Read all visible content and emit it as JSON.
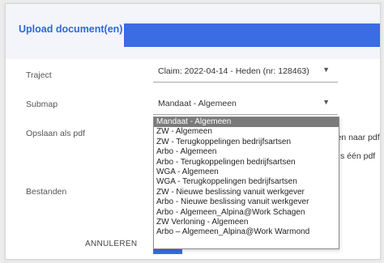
{
  "dialog": {
    "title": "Upload document(en)",
    "accent_color": "#3b6be5"
  },
  "form": {
    "traject_label": "Traject",
    "traject_value": "Claim: 2022-04-14 - Heden (nr: 128463)",
    "submap_label": "Submap",
    "submap_value": "Mandaat - Algemeen",
    "opslaan_label": "Opslaan als pdf",
    "opslaan_option_1_fragment": "ren naar pdf",
    "opslaan_option_2_fragment": "s één pdf",
    "bestanden_label": "Bestanden"
  },
  "buttons": {
    "cancel_label": "ANNULEREN"
  },
  "dropdown": {
    "options": [
      "Mandaat - Algemeen",
      "ZW - Algemeen",
      "ZW - Terugkoppelingen bedrijfsartsen",
      "Arbo - Algemeen",
      "Arbo - Terugkoppelingen bedrijfsartsen",
      "WGA - Algemeen",
      "WGA - Terugkoppelingen bedrijfsartsen",
      "ZW - Nieuwe beslissing vanuit werkgever",
      "Arbo - Nieuwe beslissing vanuit werkgever",
      "Arbo - Algemeen_Alpina@Work Schagen",
      "ZW Verloning - Algemeen",
      "Arbo – Algemeen_Alpina@Work Warmond"
    ],
    "selected_index": 0
  }
}
